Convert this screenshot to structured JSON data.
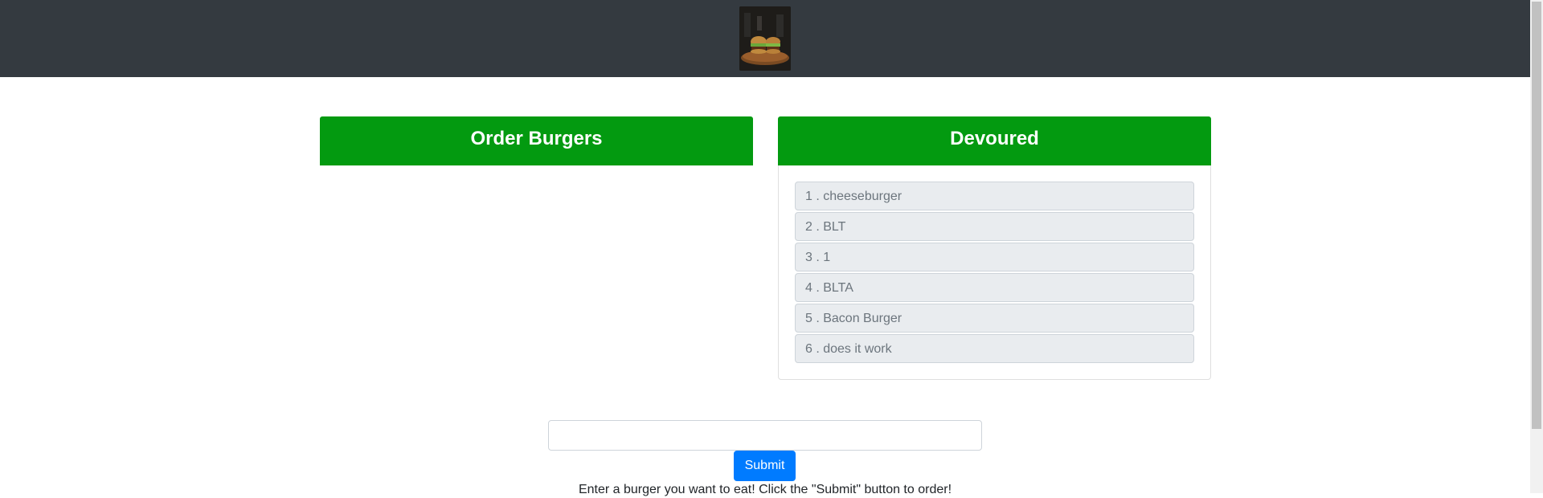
{
  "header": {
    "logo_alt": "burger photo"
  },
  "order_panel": {
    "title": "Order Burgers",
    "items": []
  },
  "devoured_panel": {
    "title": "Devoured",
    "items": [
      "1 . cheeseburger",
      "2 . BLT",
      "3 . 1",
      "4 . BLTA",
      "5 . Bacon Burger",
      "6 . does it work"
    ]
  },
  "form": {
    "input_value": "",
    "input_placeholder": "",
    "submit_label": "Submit",
    "instructions": "Enter a burger you want to eat! Click the \"Submit\" button to order!"
  },
  "colors": {
    "navbar": "#343a40",
    "header_green": "#039a10",
    "button_blue": "#007bff",
    "list_item_bg": "#e9ecef"
  }
}
